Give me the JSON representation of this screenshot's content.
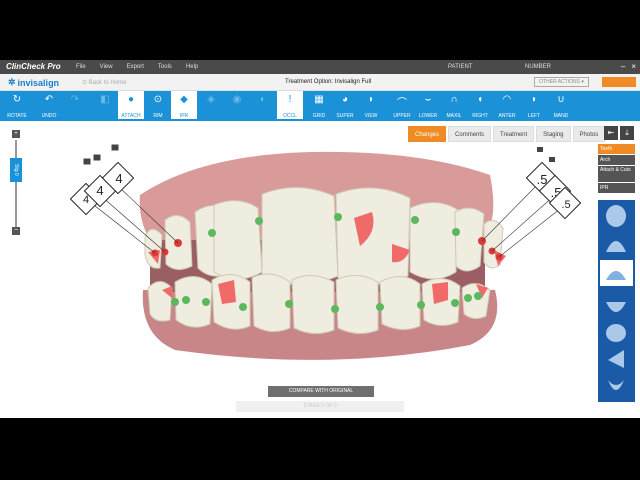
{
  "app": {
    "title": "ClinCheck Pro",
    "menu": [
      "File",
      "View",
      "Export",
      "Tools",
      "Help"
    ],
    "patient_label": "PATIENT",
    "number_label": "NUMBER",
    "window_buttons": [
      "–",
      "×"
    ]
  },
  "header": {
    "logo_text": "invisalign",
    "back_link": "Back to Home",
    "treatment_option": "Treatment Option:  Invisalign Full",
    "other_actions": "OTHER ACTIONS  ▾"
  },
  "toolbar": {
    "tools": [
      {
        "key": "rotate",
        "label": "ROTATE",
        "icon": "↻"
      },
      {
        "key": "undo",
        "label": "UNDO",
        "icon": "↶"
      },
      {
        "key": "redo",
        "label": "",
        "icon": "↷"
      },
      {
        "key": "t4",
        "label": "",
        "icon": "◧"
      },
      {
        "key": "attach",
        "label": "ATTACH",
        "icon": "●"
      },
      {
        "key": "ridge",
        "label": "RIM",
        "icon": "⊙"
      },
      {
        "key": "ipr",
        "label": "IPR",
        "icon": "◆"
      },
      {
        "key": "t8",
        "label": "",
        "icon": "◈"
      },
      {
        "key": "t9",
        "label": "",
        "icon": "◉"
      },
      {
        "key": "t10",
        "label": "",
        "icon": "◐"
      },
      {
        "key": "occl",
        "label": "OCCL",
        "icon": "!"
      },
      {
        "key": "grid",
        "label": "GRID",
        "icon": "▦"
      },
      {
        "key": "super",
        "label": "SUPER",
        "icon": "◕"
      },
      {
        "key": "view",
        "label": "VIEW",
        "icon": "◗"
      },
      {
        "key": "upper",
        "label": "UPPER",
        "icon": "⌒"
      },
      {
        "key": "lower",
        "label": "LOWER",
        "icon": "⌣"
      },
      {
        "key": "maxil",
        "label": "MAXIL",
        "icon": "∩"
      },
      {
        "key": "right",
        "label": "RIGHT",
        "icon": "◖"
      },
      {
        "key": "anter",
        "label": "ANTER",
        "icon": "◠"
      },
      {
        "key": "left",
        "label": "LEFT",
        "icon": "◗"
      },
      {
        "key": "mand",
        "label": "MAND",
        "icon": "∪"
      }
    ]
  },
  "panel_tabs": [
    "Changes",
    "Comments",
    "Treatment",
    "Staging",
    "Photos"
  ],
  "right_tabs": [
    "Teeth",
    "Arch",
    "Attach & Cuts",
    "IPR"
  ],
  "slider": {
    "plus": "+",
    "minus": "−",
    "value_label": "Stg 0"
  },
  "ipr_values": {
    "upper_right_1": "4",
    "upper_right_2": "4",
    "upper_left_1": ".5",
    "upper_left_2": ".5",
    "upper_left_3": ".5"
  },
  "buttons": {
    "compare": "COMPARE WITH ORIGINAL",
    "ghost": "STAGE 0 OF 0"
  },
  "colors": {
    "accent": "#1b92d7",
    "orange": "#f08a24",
    "attachment": "#f06a6a",
    "ipr_mark": "#d93a3a",
    "plus_mark": "#5cb85c"
  }
}
